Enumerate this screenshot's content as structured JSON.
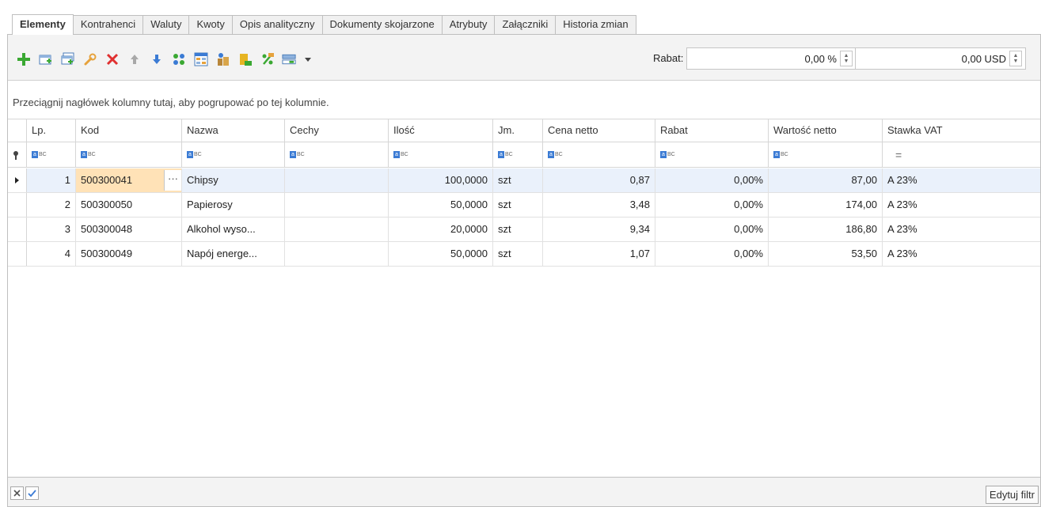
{
  "tabs": [
    "Elementy",
    "Kontrahenci",
    "Waluty",
    "Kwoty",
    "Opis analityczny",
    "Dokumenty skojarzone",
    "Atrybuty",
    "Załączniki",
    "Historia zmian"
  ],
  "toolbar": {
    "icons": [
      "add-icon",
      "add-row-icon",
      "add-multiple-icon",
      "edit-wrench-icon",
      "delete-icon",
      "move-up-icon",
      "move-down-icon",
      "split-icon",
      "table-icon",
      "set-quantity-icon",
      "batch-icon",
      "percent-icon",
      "view-options-icon",
      "dropdown-arrow-icon"
    ],
    "rabat_label": "Rabat:",
    "rabat_percent": "0,00 %",
    "rabat_amount": "0,00 USD"
  },
  "grid": {
    "group_hint": "Przeciągnij nagłówek kolumny tutaj, aby pogrupować po tej kolumnie.",
    "columns": [
      "Lp.",
      "Kod",
      "Nazwa",
      "Cechy",
      "Ilość",
      "Jm.",
      "Cena netto",
      "Rabat",
      "Wartość netto",
      "Stawka VAT"
    ],
    "rows": [
      {
        "lp": "1",
        "kod": "500300041",
        "nazwa": "Chipsy",
        "cechy": "",
        "ilosc": "100,0000",
        "jm": "szt",
        "cena": "0,87",
        "rabat": "0,00%",
        "wartosc": "87,00",
        "vat": "A 23%"
      },
      {
        "lp": "2",
        "kod": "500300050",
        "nazwa": "Papierosy",
        "cechy": "",
        "ilosc": "50,0000",
        "jm": "szt",
        "cena": "3,48",
        "rabat": "0,00%",
        "wartosc": "174,00",
        "vat": "A 23%"
      },
      {
        "lp": "3",
        "kod": "500300048",
        "nazwa": "Alkohol wyso...",
        "cechy": "",
        "ilosc": "20,0000",
        "jm": "szt",
        "cena": "9,34",
        "rabat": "0,00%",
        "wartosc": "186,80",
        "vat": "A 23%"
      },
      {
        "lp": "4",
        "kod": "500300049",
        "nazwa": "Napój energe...",
        "cechy": "",
        "ilosc": "50,0000",
        "jm": "szt",
        "cena": "1,07",
        "rabat": "0,00%",
        "wartosc": "53,50",
        "vat": "A 23%"
      }
    ],
    "selected_row": 1
  },
  "footer": {
    "edit_filter_label": "Edytuj filtr"
  }
}
